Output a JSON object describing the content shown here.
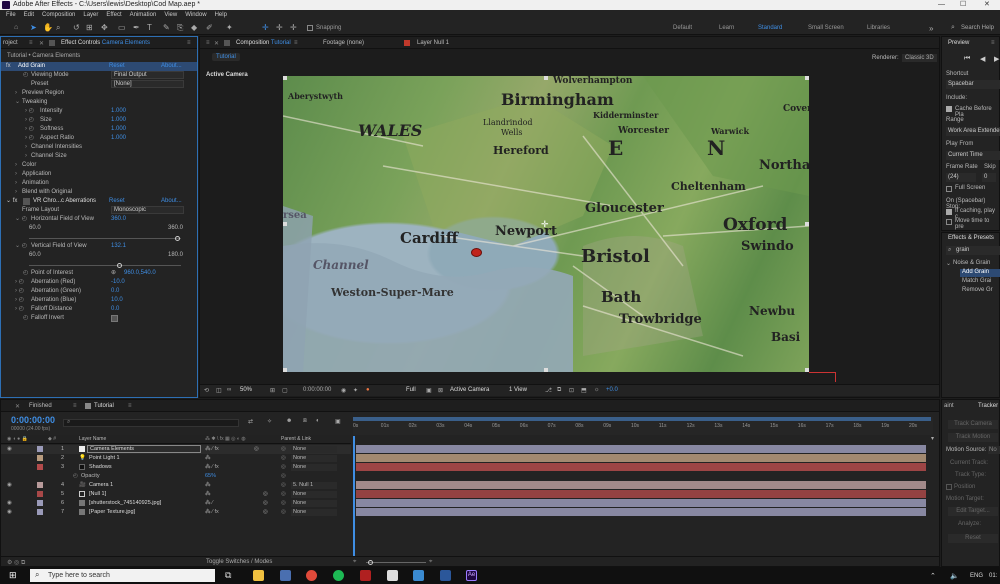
{
  "window": {
    "title": "Adobe After Effects - C:\\Users\\lewis\\Desktop\\Cod Map.aep *"
  },
  "menu": [
    "File",
    "Edit",
    "Composition",
    "Layer",
    "Effect",
    "Animation",
    "View",
    "Window",
    "Help"
  ],
  "toolbar": {
    "snapping": "Snapping",
    "workspaces": [
      "Default",
      "Learn",
      "Standard",
      "Small Screen",
      "Libraries"
    ],
    "search_placeholder": "Search Help"
  },
  "effect_controls": {
    "tab_project": "roject",
    "tab_label": "Effect Controls",
    "tab_target": "Camera Elements",
    "subtitle": "Tutorial • Camera Elements",
    "rows": [
      {
        "label": "Add Grain",
        "link": "Reset",
        "link2": "About..."
      },
      {
        "label": "Viewing Mode",
        "value": "Final Output"
      },
      {
        "label": "Preset",
        "value": "[None]"
      },
      {
        "label": "Preview Region"
      },
      {
        "label": "Tweaking"
      },
      {
        "label": "Intensity",
        "value": "1.000"
      },
      {
        "label": "Size",
        "value": "1.000"
      },
      {
        "label": "Softness",
        "value": "1.000"
      },
      {
        "label": "Aspect Ratio",
        "value": "1.000"
      },
      {
        "label": "Channel Intensities"
      },
      {
        "label": "Channel Size"
      },
      {
        "label": "Color"
      },
      {
        "label": "Application"
      },
      {
        "label": "Animation"
      },
      {
        "label": "Blend with Original"
      },
      {
        "label": "VR Chro...c Aberrations",
        "link": "Reset",
        "link2": "About..."
      },
      {
        "label": "Frame Layout",
        "value": "Monoscopic"
      },
      {
        "label": "Horizontal Field of View",
        "value": "360.0"
      },
      {
        "label": "60.0",
        "value": "360.0"
      },
      {
        "label": "Vertical Field of View",
        "value": "132.1"
      },
      {
        "label": "60.0",
        "value": "180.0"
      },
      {
        "label": "Point of Interest",
        "value": "960.0,540.0"
      },
      {
        "label": "Aberration (Red)",
        "value": "-10.0"
      },
      {
        "label": "Aberration (Green)",
        "value": "0.0"
      },
      {
        "label": "Aberration (Blue)",
        "value": "10.0"
      },
      {
        "label": "Falloff Distance",
        "value": "0.0"
      },
      {
        "label": "Falloff Invert",
        "value": ""
      }
    ]
  },
  "composition": {
    "tab_label": "Composition",
    "tab_name": "Tutorial",
    "footage_tab": "Footage (none)",
    "layer_tab": "Layer Null 1",
    "comp_chip": "Tutorial",
    "renderer_label": "Renderer:",
    "renderer_value": "Classic 3D",
    "view_label": "Active Camera",
    "footer": {
      "zoom": "50%",
      "time": "0:00:00:00",
      "quality": "Full",
      "camera": "Active Camera",
      "views": "1 View",
      "offset": "+0.0"
    }
  },
  "map_labels": [
    {
      "text": "Wolverhampton",
      "size": 9
    },
    {
      "text": "Birmingham",
      "size": 16
    },
    {
      "text": "Coven",
      "size": 9
    },
    {
      "text": "Aberystwyth",
      "size": 8
    },
    {
      "text": "WALES",
      "size": 16
    },
    {
      "text": "Llandrindod",
      "size": 8
    },
    {
      "text": "Wells",
      "size": 8
    },
    {
      "text": "Kidderminster",
      "size": 8
    },
    {
      "text": "Worcester",
      "size": 9
    },
    {
      "text": "Warwick",
      "size": 8
    },
    {
      "text": "Hereford",
      "size": 11
    },
    {
      "text": "E",
      "size": 20
    },
    {
      "text": "N",
      "size": 20
    },
    {
      "text": "Northa",
      "size": 13
    },
    {
      "text": "Cheltenham",
      "size": 11
    },
    {
      "text": "Gloucester",
      "size": 13
    },
    {
      "text": "Oxford",
      "size": 17
    },
    {
      "text": "Swindo",
      "size": 13
    },
    {
      "text": "Cardiff",
      "size": 15
    },
    {
      "text": "Newport",
      "size": 13
    },
    {
      "text": "Bristol",
      "size": 18
    },
    {
      "text": "Channel",
      "size": 12
    },
    {
      "text": "Weston-Super-Mare",
      "size": 11
    },
    {
      "text": "Bath",
      "size": 15
    },
    {
      "text": "Trowbridge",
      "size": 13
    },
    {
      "text": "Newbu",
      "size": 12
    },
    {
      "text": "Basi",
      "size": 12
    },
    {
      "text": "rsea",
      "size": 10
    }
  ],
  "right_panel": {
    "preview_title": "Preview",
    "shortcut_label": "Shortcut",
    "shortcut_value": "Spacebar",
    "include_label": "Include:",
    "cache_label": "Cache Before Pla",
    "range_label": "Range",
    "range_value": "Work Area Extende",
    "play_from_label": "Play From",
    "play_from_value": "Current Time",
    "frame_rate_label": "Frame Rate",
    "skip_label": "Skip",
    "frame_rate_value": "(24)",
    "skip_value": "0",
    "full_screen": "Full Screen",
    "on_stop": "On (Spacebar) Stop:",
    "if_caching": "If caching, play c",
    "move_time": "Move time to pre",
    "effects_title": "Effects & Presets",
    "effects_search": "grain",
    "effects_category": "Noise & Grain",
    "effects_items": [
      "Add Grain",
      "Match Grai",
      "Remove Gr"
    ]
  },
  "timeline": {
    "tab_finished": "Finished",
    "tab_tutorial": "Tutorial",
    "current_time": "0:00:00:00",
    "fps": "00000 (24.00 fps)",
    "columns": {
      "layer_name": "Layer Name",
      "parent": "Parent & Link"
    },
    "ticks": [
      "0s",
      "01s",
      "02s",
      "03s",
      "04s",
      "05s",
      "06s",
      "07s",
      "08s",
      "09s",
      "10s",
      "11s",
      "12s",
      "13s",
      "14s",
      "15s",
      "16s",
      "17s",
      "18s",
      "19s",
      "20s"
    ],
    "layers": [
      {
        "num": "1",
        "name": "Camera Elements",
        "parent": "None",
        "color": "#9a9ab8"
      },
      {
        "num": "2",
        "name": "Point Light 1",
        "parent": "None",
        "color": "#b89b7e"
      },
      {
        "num": "3",
        "name": "Shadows",
        "parent": "None",
        "color": "#b34b4b"
      },
      {
        "num": "",
        "name": "Opacity",
        "parent": "",
        "value": "65%",
        "color": ""
      },
      {
        "num": "4",
        "name": "Camera 1",
        "parent": "5. Null 1",
        "color": "#b89b9b"
      },
      {
        "num": "5",
        "name": "[Null 1]",
        "parent": "None",
        "color": "#a84848"
      },
      {
        "num": "6",
        "name": "[shutterstock_745140925.jpg]",
        "parent": "None",
        "color": "#9a9ab8"
      },
      {
        "num": "7",
        "name": "[Paper Texture.jpg]",
        "parent": "None",
        "color": "#9a9ab8"
      }
    ],
    "toggle_label": "Toggle Switches / Modes"
  },
  "tracker": {
    "tab_paint": "aint",
    "tab_tracker": "Tracker",
    "items": [
      "Track Camera",
      "Track Motion",
      "Motion Source:",
      "Current Track:",
      "Track Type:",
      "Position",
      "Motion Target:",
      "Edit Target...",
      "Analyze:",
      "Reset"
    ],
    "motion_source_value": "No"
  },
  "taskbar": {
    "search_placeholder": "Type here to search",
    "lang": "ENG",
    "time": "01:"
  }
}
